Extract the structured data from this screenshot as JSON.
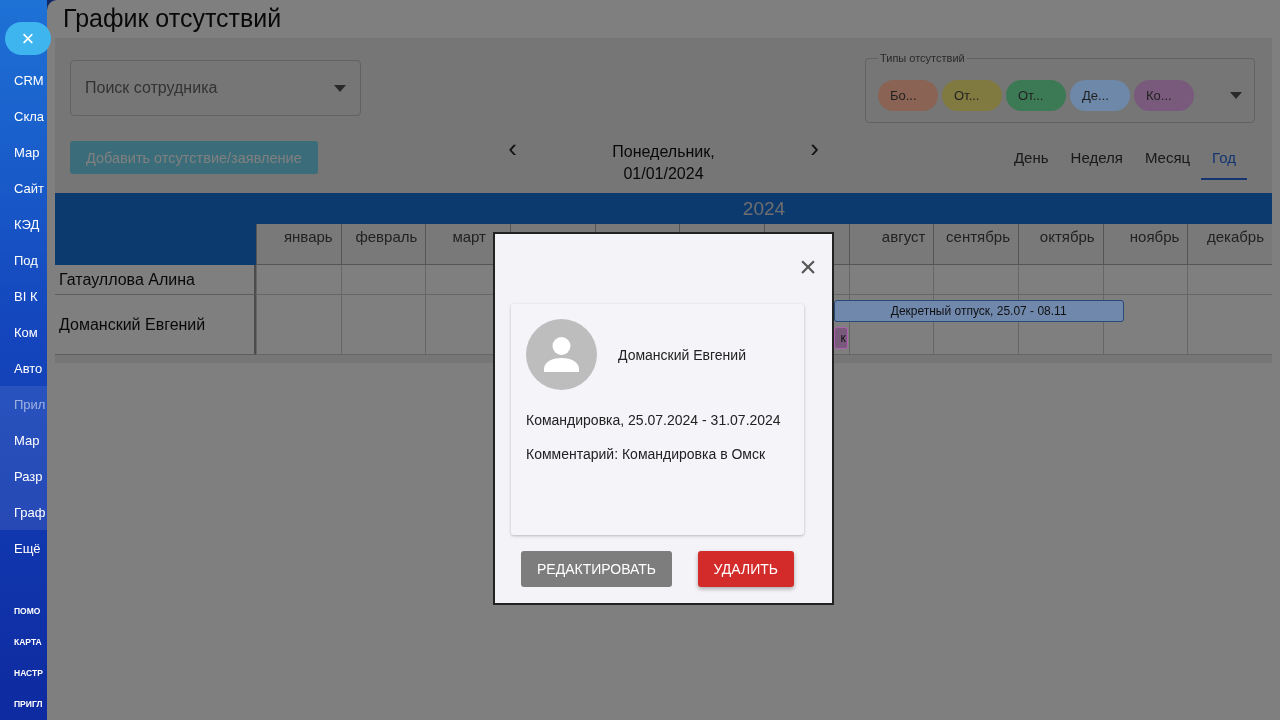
{
  "sidebar": {
    "close_button": "×",
    "items": [
      {
        "label": "CRM",
        "kind": "item"
      },
      {
        "label": "Скла",
        "kind": "item"
      },
      {
        "label": "Мар",
        "kind": "item"
      },
      {
        "label": "Сайт",
        "kind": "item"
      },
      {
        "label": "КЭД",
        "kind": "item"
      },
      {
        "label": "Под",
        "kind": "item"
      },
      {
        "label": "BI К",
        "kind": "item"
      },
      {
        "label": "Ком",
        "kind": "item"
      },
      {
        "label": "Авто",
        "kind": "item"
      },
      {
        "label": "Прил",
        "kind": "group-title"
      },
      {
        "label": "Мар",
        "kind": "group-item"
      },
      {
        "label": "Разр",
        "kind": "group-item"
      },
      {
        "label": "Граф",
        "kind": "group-item"
      },
      {
        "label": "Ещё",
        "kind": "item"
      }
    ],
    "footer_links": [
      "ПОМО",
      "КАРТА",
      "НАСТР",
      "ПРИГЛ"
    ]
  },
  "page": {
    "title": "График отсутствий",
    "search": {
      "placeholder": "Поиск сотрудника"
    },
    "absence_types": {
      "legend": "Типы отсутствий",
      "chips": [
        {
          "label": "Бо...",
          "color": "#8a6354"
        },
        {
          "label": "От...",
          "color": "#807a40"
        },
        {
          "label": "От...",
          "color": "#3c7a56"
        },
        {
          "label": "Де...",
          "color": "#6e88aa"
        },
        {
          "label": "Ко...",
          "color": "#7a5a7c"
        }
      ]
    },
    "add_button": "Добавить отсутствие/заявление",
    "date": {
      "prev": "‹",
      "next": "›",
      "line_1": "Понедельник,",
      "line_2": "01/01/2024"
    },
    "views": [
      {
        "label": "День",
        "selected": false
      },
      {
        "label": "Неделя",
        "selected": false
      },
      {
        "label": "Месяц",
        "selected": false
      },
      {
        "label": "Год",
        "selected": true
      }
    ],
    "table": {
      "year": "2024",
      "months_before": [
        "январь",
        "февраль",
        "март"
      ],
      "months_after": [
        "август",
        "сентябрь",
        "октябрь",
        "ноябрь",
        "декабрь"
      ],
      "rows": [
        {
          "name": "Гатауллова Алина"
        },
        {
          "name": "Доманский Евгений",
          "bars": [
            {
              "label": "Декретный отпуск, 25.07 - 08.11",
              "color": "#7088ac",
              "kind": "full"
            },
            {
              "label": "к",
              "color": "#7a5a7c",
              "kind": "clipped"
            }
          ]
        }
      ]
    }
  },
  "dialog": {
    "close": "×",
    "name": "Доманский Евгений",
    "absence": "Командировка, 25.07.2024 - 31.07.2024",
    "comment": "Комментарий: Командировка в Омск",
    "buttons": [
      {
        "label": "РЕДАКТИРОВАТЬ",
        "kind": "secondary"
      },
      {
        "label": "УДАЛИТЬ",
        "kind": "danger"
      }
    ]
  }
}
